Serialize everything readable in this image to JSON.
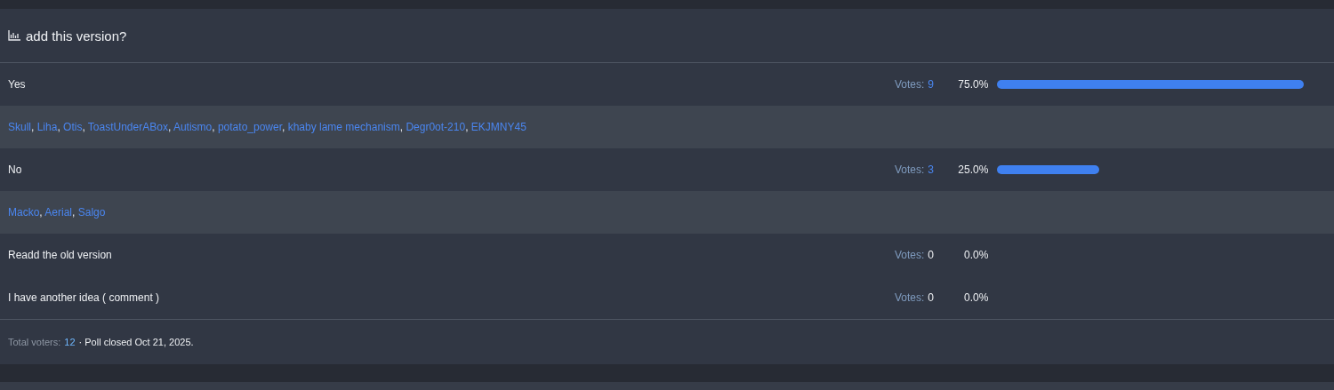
{
  "poll": {
    "title": "add this version?",
    "options": [
      {
        "label": "Yes",
        "votes_label": "Votes:",
        "votes": "9",
        "votes_link": true,
        "percent": "75.0%",
        "separator": ", ",
        "voters": [
          "Skull",
          "Liha",
          "Otis",
          "ToastUnderABox",
          "Autismo",
          "potato_power",
          "khaby lame mechanism",
          "Degr0ot-210",
          "EKJMNY45"
        ]
      },
      {
        "label": "No",
        "votes_label": "Votes:",
        "votes": "3",
        "votes_link": true,
        "percent": "25.0%",
        "separator": ", ",
        "voters": [
          "Macko",
          "Aerial",
          "Salgo"
        ]
      },
      {
        "label": "Readd the old version",
        "votes_label": "Votes:",
        "votes": "0",
        "votes_link": false,
        "percent": "0.0%"
      },
      {
        "label": "I have another idea ( comment )",
        "votes_label": "Votes:",
        "votes": "0",
        "votes_link": false,
        "percent": "0.0%"
      }
    ],
    "footer": {
      "label": "Total voters:",
      "count": "12",
      "status": "· Poll closed Oct 21, 2025."
    }
  }
}
